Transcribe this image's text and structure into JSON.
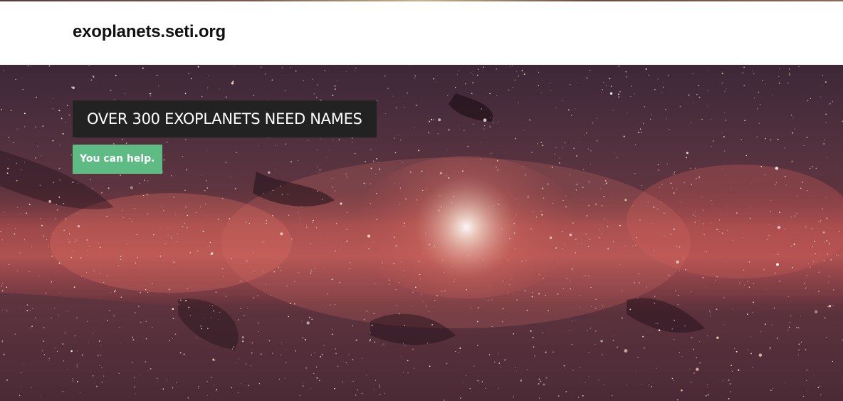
{
  "site": {
    "brand": "exoplanets.seti.org"
  },
  "hero": {
    "headline": "OVER 300 EXOPLANETS NEED NAMES",
    "cta_label": "You can help."
  },
  "colors": {
    "navbar_bg": "#ffffff",
    "brand_text": "#111111",
    "headline_bg": "#222222",
    "cta_bg": "#5fbb84"
  },
  "images": {
    "hero_background": "milky-way-galactic-center"
  }
}
